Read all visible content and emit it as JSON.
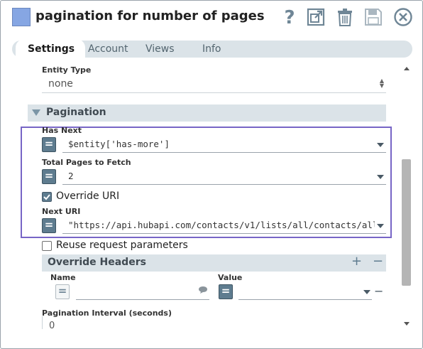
{
  "header": {
    "title": "pagination for number of pages",
    "icons": [
      "help-icon",
      "export-icon",
      "trash-icon",
      "save-icon",
      "close-icon"
    ]
  },
  "tabs": [
    {
      "label": "Settings",
      "active": true
    },
    {
      "label": "Account",
      "active": false
    },
    {
      "label": "Views",
      "active": false
    },
    {
      "label": "Info",
      "active": false
    }
  ],
  "form": {
    "entity_type": {
      "label": "Entity Type",
      "value": "none"
    },
    "pagination": {
      "title": "Pagination",
      "has_next": {
        "label": "Has Next",
        "value": "$entity['has-more']",
        "expression_enabled": true
      },
      "total_pages": {
        "label": "Total Pages to Fetch",
        "value": "2",
        "expression_enabled": true
      },
      "override_uri": {
        "label": "Override URI",
        "checked": true
      },
      "next_uri": {
        "label": "Next URI",
        "value": "\"https://api.hubapi.com/contacts/v1/lists/all/contacts/all",
        "expression_enabled": true
      },
      "reuse_params": {
        "label": "Reuse request parameters",
        "checked": false
      },
      "override_headers": {
        "title": "Override Headers",
        "add_symbol": "+",
        "remove_symbol": "−",
        "name_label": "Name",
        "value_label": "Value",
        "name_value": "",
        "value_value": ""
      },
      "interval": {
        "label": "Pagination Interval (seconds)",
        "value": "0"
      }
    }
  },
  "colors": {
    "accent": "#5e7c8f",
    "highlight_border": "#7765c6",
    "section_bg": "#dbe3e8",
    "snap_icon": "#86a6e3"
  }
}
